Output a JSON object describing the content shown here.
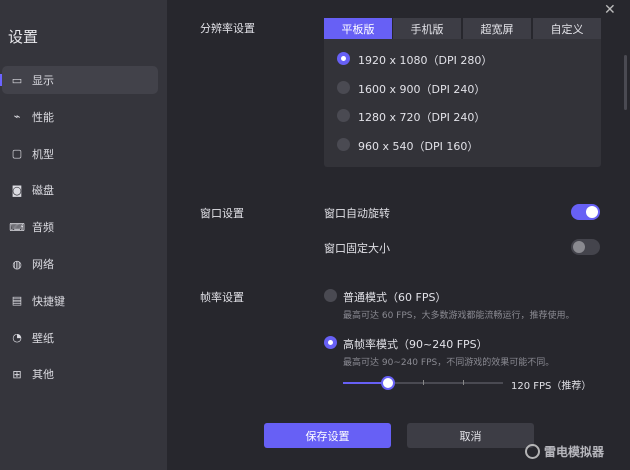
{
  "sidebar": {
    "title": "设置",
    "items": [
      {
        "label": "显示",
        "icon": "monitor-icon"
      },
      {
        "label": "性能",
        "icon": "activity-icon"
      },
      {
        "label": "机型",
        "icon": "device-icon"
      },
      {
        "label": "磁盘",
        "icon": "disk-icon"
      },
      {
        "label": "音频",
        "icon": "gamepad-icon"
      },
      {
        "label": "网络",
        "icon": "globe-icon"
      },
      {
        "label": "快捷键",
        "icon": "keyboard-icon"
      },
      {
        "label": "壁纸",
        "icon": "palette-icon"
      },
      {
        "label": "其他",
        "icon": "grid-icon"
      }
    ]
  },
  "resolution": {
    "label": "分辨率设置",
    "tabs": [
      "平板版",
      "手机版",
      "超宽屏",
      "自定义"
    ],
    "options": [
      "1920 x 1080（DPI 280）",
      "1600 x 900（DPI 240）",
      "1280 x 720（DPI 240）",
      "960 x 540（DPI 160）"
    ],
    "selected": 0
  },
  "window": {
    "label": "窗口设置",
    "auto_rotate": "窗口自动旋转",
    "auto_rotate_on": true,
    "fixed_size": "窗口固定大小",
    "fixed_size_on": false
  },
  "fps": {
    "label": "帧率设置",
    "normal": "普通模式（60 FPS）",
    "normal_desc": "最高可达 60 FPS，大多数游戏都能流畅运行，推荐使用。",
    "high": "高帧率模式（90~240 FPS）",
    "high_desc": "最高可达 90~240 FPS，不同游戏的效果可能不同。",
    "slider_value": "120 FPS（推荐）",
    "slider_fraction": 0.28
  },
  "buttons": {
    "save": "保存设置",
    "cancel": "取消"
  },
  "logo": "雷电模拟器",
  "colors": {
    "accent": "#6760f5"
  }
}
